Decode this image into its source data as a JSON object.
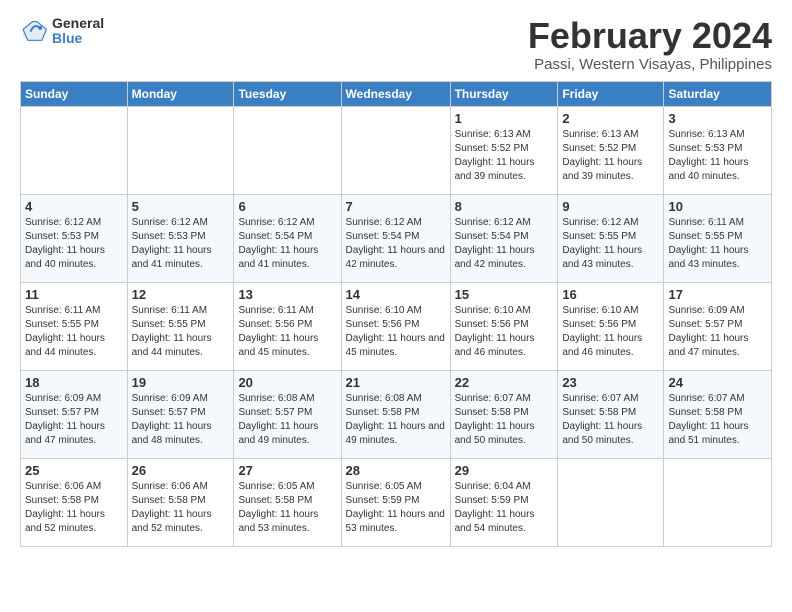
{
  "logo": {
    "general": "General",
    "blue": "Blue"
  },
  "title": "February 2024",
  "subtitle": "Passi, Western Visayas, Philippines",
  "header": {
    "days": [
      "Sunday",
      "Monday",
      "Tuesday",
      "Wednesday",
      "Thursday",
      "Friday",
      "Saturday"
    ]
  },
  "weeks": [
    [
      {
        "day": "",
        "info": ""
      },
      {
        "day": "",
        "info": ""
      },
      {
        "day": "",
        "info": ""
      },
      {
        "day": "",
        "info": ""
      },
      {
        "day": "1",
        "info": "Sunrise: 6:13 AM\nSunset: 5:52 PM\nDaylight: 11 hours and 39 minutes."
      },
      {
        "day": "2",
        "info": "Sunrise: 6:13 AM\nSunset: 5:52 PM\nDaylight: 11 hours and 39 minutes."
      },
      {
        "day": "3",
        "info": "Sunrise: 6:13 AM\nSunset: 5:53 PM\nDaylight: 11 hours and 40 minutes."
      }
    ],
    [
      {
        "day": "4",
        "info": "Sunrise: 6:12 AM\nSunset: 5:53 PM\nDaylight: 11 hours and 40 minutes."
      },
      {
        "day": "5",
        "info": "Sunrise: 6:12 AM\nSunset: 5:53 PM\nDaylight: 11 hours and 41 minutes."
      },
      {
        "day": "6",
        "info": "Sunrise: 6:12 AM\nSunset: 5:54 PM\nDaylight: 11 hours and 41 minutes."
      },
      {
        "day": "7",
        "info": "Sunrise: 6:12 AM\nSunset: 5:54 PM\nDaylight: 11 hours and 42 minutes."
      },
      {
        "day": "8",
        "info": "Sunrise: 6:12 AM\nSunset: 5:54 PM\nDaylight: 11 hours and 42 minutes."
      },
      {
        "day": "9",
        "info": "Sunrise: 6:12 AM\nSunset: 5:55 PM\nDaylight: 11 hours and 43 minutes."
      },
      {
        "day": "10",
        "info": "Sunrise: 6:11 AM\nSunset: 5:55 PM\nDaylight: 11 hours and 43 minutes."
      }
    ],
    [
      {
        "day": "11",
        "info": "Sunrise: 6:11 AM\nSunset: 5:55 PM\nDaylight: 11 hours and 44 minutes."
      },
      {
        "day": "12",
        "info": "Sunrise: 6:11 AM\nSunset: 5:55 PM\nDaylight: 11 hours and 44 minutes."
      },
      {
        "day": "13",
        "info": "Sunrise: 6:11 AM\nSunset: 5:56 PM\nDaylight: 11 hours and 45 minutes."
      },
      {
        "day": "14",
        "info": "Sunrise: 6:10 AM\nSunset: 5:56 PM\nDaylight: 11 hours and 45 minutes."
      },
      {
        "day": "15",
        "info": "Sunrise: 6:10 AM\nSunset: 5:56 PM\nDaylight: 11 hours and 46 minutes."
      },
      {
        "day": "16",
        "info": "Sunrise: 6:10 AM\nSunset: 5:56 PM\nDaylight: 11 hours and 46 minutes."
      },
      {
        "day": "17",
        "info": "Sunrise: 6:09 AM\nSunset: 5:57 PM\nDaylight: 11 hours and 47 minutes."
      }
    ],
    [
      {
        "day": "18",
        "info": "Sunrise: 6:09 AM\nSunset: 5:57 PM\nDaylight: 11 hours and 47 minutes."
      },
      {
        "day": "19",
        "info": "Sunrise: 6:09 AM\nSunset: 5:57 PM\nDaylight: 11 hours and 48 minutes."
      },
      {
        "day": "20",
        "info": "Sunrise: 6:08 AM\nSunset: 5:57 PM\nDaylight: 11 hours and 49 minutes."
      },
      {
        "day": "21",
        "info": "Sunrise: 6:08 AM\nSunset: 5:58 PM\nDaylight: 11 hours and 49 minutes."
      },
      {
        "day": "22",
        "info": "Sunrise: 6:07 AM\nSunset: 5:58 PM\nDaylight: 11 hours and 50 minutes."
      },
      {
        "day": "23",
        "info": "Sunrise: 6:07 AM\nSunset: 5:58 PM\nDaylight: 11 hours and 50 minutes."
      },
      {
        "day": "24",
        "info": "Sunrise: 6:07 AM\nSunset: 5:58 PM\nDaylight: 11 hours and 51 minutes."
      }
    ],
    [
      {
        "day": "25",
        "info": "Sunrise: 6:06 AM\nSunset: 5:58 PM\nDaylight: 11 hours and 52 minutes."
      },
      {
        "day": "26",
        "info": "Sunrise: 6:06 AM\nSunset: 5:58 PM\nDaylight: 11 hours and 52 minutes."
      },
      {
        "day": "27",
        "info": "Sunrise: 6:05 AM\nSunset: 5:58 PM\nDaylight: 11 hours and 53 minutes."
      },
      {
        "day": "28",
        "info": "Sunrise: 6:05 AM\nSunset: 5:59 PM\nDaylight: 11 hours and 53 minutes."
      },
      {
        "day": "29",
        "info": "Sunrise: 6:04 AM\nSunset: 5:59 PM\nDaylight: 11 hours and 54 minutes."
      },
      {
        "day": "",
        "info": ""
      },
      {
        "day": "",
        "info": ""
      }
    ]
  ]
}
